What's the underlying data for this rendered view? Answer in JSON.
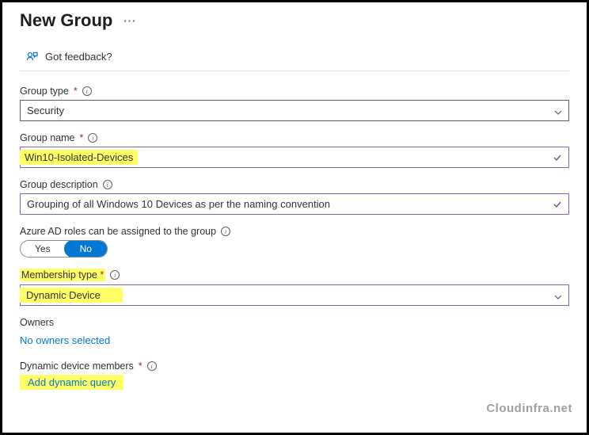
{
  "header": {
    "title": "New Group",
    "feedback_label": "Got feedback?"
  },
  "fields": {
    "group_type": {
      "label": "Group type",
      "value": "Security"
    },
    "group_name": {
      "label": "Group name",
      "value": "Win10-Isolated-Devices"
    },
    "group_description": {
      "label": "Group description",
      "value": "Grouping of all Windows 10 Devices as per the naming convention"
    },
    "azure_roles": {
      "label": "Azure AD roles can be assigned to the group",
      "yes": "Yes",
      "no": "No"
    },
    "membership_type": {
      "label": "Membership type",
      "value": "Dynamic Device"
    },
    "owners": {
      "label": "Owners",
      "link": "No owners selected"
    },
    "dynamic_members": {
      "label": "Dynamic device members",
      "button": "Add dynamic query"
    }
  },
  "watermark": "Cloudinfra.net"
}
